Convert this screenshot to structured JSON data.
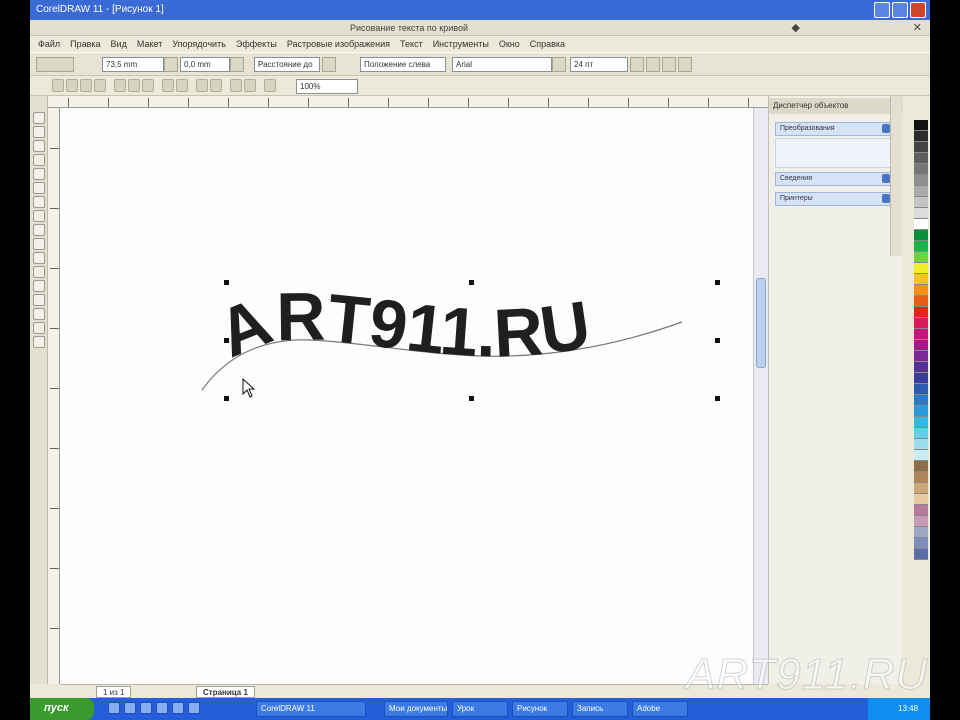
{
  "window": {
    "title": "CorelDRAW 11 - [Рисунок 1]"
  },
  "document": {
    "title": "Рисование текста по кривой"
  },
  "menu": [
    "Файл",
    "Правка",
    "Вид",
    "Макет",
    "Упорядочить",
    "Эффекты",
    "Растровые изображения",
    "Текст",
    "Инструменты",
    "Окно",
    "Справка"
  ],
  "propbar": {
    "width": "73,5 mm",
    "offset": "0,0 mm",
    "mirror": "Расстояние до",
    "orientation": "Положение слева",
    "font": "Arial",
    "size": "24 пт"
  },
  "stdbar": {
    "zoom": "100%"
  },
  "artwork": {
    "text": "ART911.RU"
  },
  "docker": {
    "title": "Диспетчер объектов",
    "sections": [
      "Преобразования",
      "Сведения",
      "Принтеры"
    ]
  },
  "pagebar": {
    "counter": "1 из 1",
    "page_tab": "Страница 1"
  },
  "taskbar": {
    "start": "пуск",
    "tasks": [
      "CorelDRAW 11",
      "Мои документы",
      "Урок",
      "Рисунок",
      "Запись",
      "Adobe"
    ],
    "clock": "13:48"
  },
  "watermark": "ART911.RU",
  "palette": [
    "#111111",
    "#2b2b2b",
    "#444444",
    "#5e5e5e",
    "#777777",
    "#909090",
    "#aaaaaa",
    "#c4c4c4",
    "#dcdcdc",
    "#ffffff",
    "#0a8f3c",
    "#1fb24a",
    "#6fd04a",
    "#f2ee26",
    "#f7c51c",
    "#f29017",
    "#ea5b16",
    "#e3231c",
    "#d81b5a",
    "#c2187c",
    "#a21b8a",
    "#7c2796",
    "#552f98",
    "#3a3c9e",
    "#2d5bb0",
    "#2a79c4",
    "#2a9bd8",
    "#33b8e6",
    "#66cde9",
    "#9adcec",
    "#c8ecf2",
    "#8d6e4a",
    "#b08558",
    "#cda777",
    "#e5cb9f",
    "#b77a9b",
    "#c99ab4",
    "#9aa8c6",
    "#7b8fb9",
    "#5c6ea8"
  ]
}
